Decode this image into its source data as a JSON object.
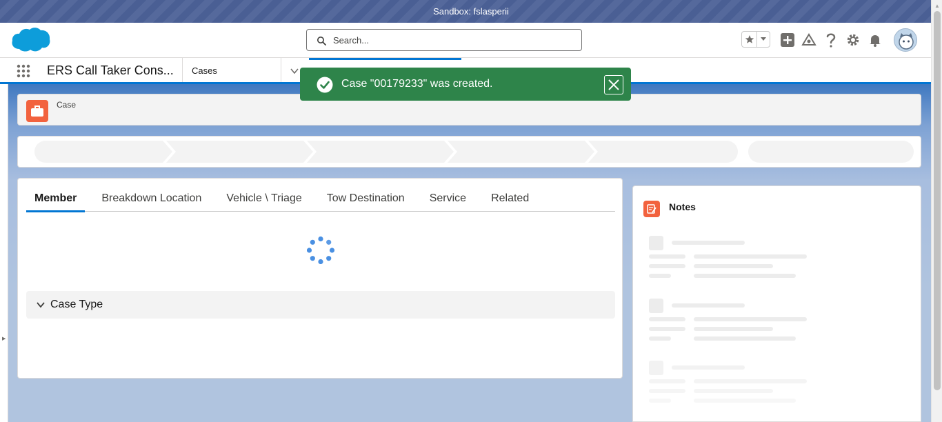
{
  "sandbox": {
    "label": "Sandbox: fslasperii"
  },
  "header": {
    "search_placeholder": "Search...",
    "icons": [
      "favorites-star-icon",
      "favorites-dropdown-icon",
      "global-create-icon",
      "trailhead-icon",
      "help-icon",
      "setup-gear-icon",
      "notifications-bell-icon",
      "user-avatar"
    ]
  },
  "nav": {
    "app_name": "ERS Call Taker Cons...",
    "tabs": [
      {
        "label": "Cases"
      },
      {
        "label": ""
      }
    ]
  },
  "toast": {
    "message": "Case \"00179233\" was created.",
    "color": "#2e844a"
  },
  "record": {
    "object_label": "Case",
    "icon": "case-briefcase-icon",
    "icon_color": "#f2623e"
  },
  "main_tabs": [
    {
      "label": "Member",
      "active": true
    },
    {
      "label": "Breakdown Location",
      "active": false
    },
    {
      "label": "Vehicle \\ Triage",
      "active": false
    },
    {
      "label": "Tow Destination",
      "active": false
    },
    {
      "label": "Service",
      "active": false
    },
    {
      "label": "Related",
      "active": false
    }
  ],
  "section": {
    "title": "Case Type",
    "expanded": true
  },
  "notes": {
    "title": "Notes",
    "icon": "notes-icon"
  },
  "colors": {
    "brand_blue": "#0176d3",
    "success_green": "#2e844a",
    "orange": "#f2623e"
  }
}
